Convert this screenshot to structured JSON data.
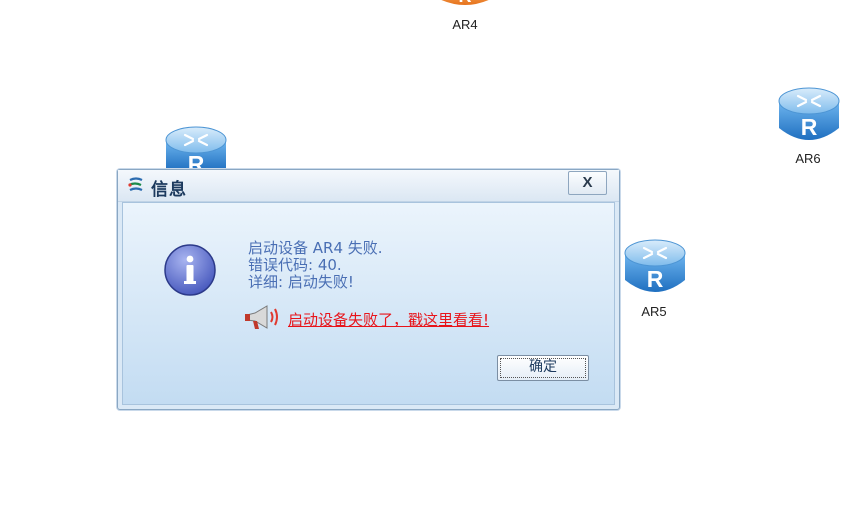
{
  "topology": {
    "nodes": [
      {
        "id": "ar4",
        "label": "AR4",
        "color": "#f08a2e"
      },
      {
        "id": "ar6",
        "label": "AR6",
        "color": "#3a8fd8"
      },
      {
        "id": "ar5",
        "label": "AR5",
        "color": "#3a8fd8"
      },
      {
        "id": "router-partial",
        "label": "",
        "color": "#3a8fd8"
      }
    ],
    "router_letter": "R"
  },
  "dialog": {
    "title": "信息",
    "close_label": "X",
    "lines": [
      "启动设备 AR4 失败.",
      "错误代码: 40.",
      "详细: 启动失败!"
    ],
    "help_link": "启动设备失败了，戳这里看看!",
    "ok_label": "确定"
  }
}
